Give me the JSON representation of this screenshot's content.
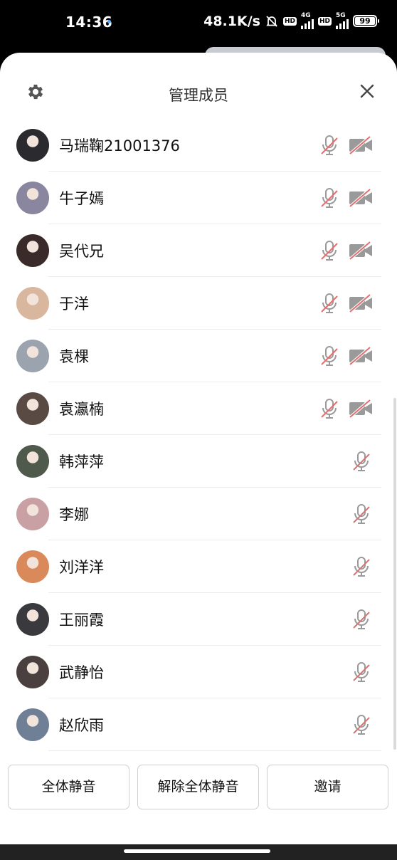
{
  "status_bar": {
    "time": "14:36",
    "network_speed": "48.1K/s",
    "hd_label": "HD",
    "net_4g": "4G",
    "net_5g": "5G",
    "battery": "99",
    "icons": [
      "bell-off-icon",
      "signal-icon",
      "battery-icon"
    ]
  },
  "header": {
    "title": "管理成员",
    "settings_icon": "gear-icon",
    "close_icon": "close-icon"
  },
  "members": [
    {
      "name": "马瑞鞠21001376",
      "mic_muted": true,
      "camera_off": true,
      "avatar_color": "#2b2b2f"
    },
    {
      "name": "牛子嫣",
      "mic_muted": true,
      "camera_off": true,
      "avatar_color": "#8a86a0"
    },
    {
      "name": "吴代兄",
      "mic_muted": true,
      "camera_off": true,
      "avatar_color": "#3a2a2a"
    },
    {
      "name": "于洋",
      "mic_muted": true,
      "camera_off": true,
      "avatar_color": "#d9b79e"
    },
    {
      "name": "袁棵",
      "mic_muted": true,
      "camera_off": true,
      "avatar_color": "#9aa3ae"
    },
    {
      "name": "袁瀛楠",
      "mic_muted": true,
      "camera_off": true,
      "avatar_color": "#5a4a44"
    },
    {
      "name": "韩萍萍",
      "mic_muted": true,
      "camera_off": false,
      "avatar_color": "#4f5a4c"
    },
    {
      "name": "李娜",
      "mic_muted": true,
      "camera_off": false,
      "avatar_color": "#c9a0a4"
    },
    {
      "name": "刘洋洋",
      "mic_muted": true,
      "camera_off": false,
      "avatar_color": "#d9895a"
    },
    {
      "name": "王丽霞",
      "mic_muted": true,
      "camera_off": false,
      "avatar_color": "#3a3a3e"
    },
    {
      "name": "武静怡",
      "mic_muted": true,
      "camera_off": false,
      "avatar_color": "#4a4040"
    },
    {
      "name": "赵欣雨",
      "mic_muted": true,
      "camera_off": false,
      "avatar_color": "#6e7f96"
    }
  ],
  "footer": {
    "mute_all": "全体静音",
    "unmute_all": "解除全体静音",
    "invite": "邀请"
  },
  "colors": {
    "icon_gray": "#9a9a9a",
    "mute_slash": "#e07070",
    "header_icon": "#555555"
  }
}
